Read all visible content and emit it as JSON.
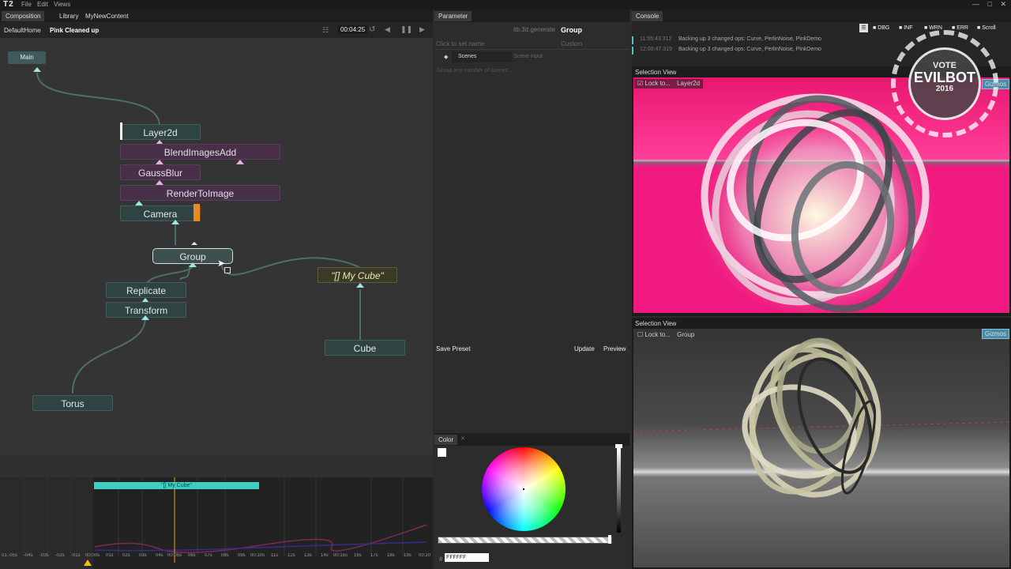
{
  "app": {
    "logo": "T2",
    "menu": [
      "File",
      "Edit",
      "Views"
    ]
  },
  "composition": {
    "tabs": [
      "Composition",
      "Library",
      "MyNewContent"
    ],
    "breadcrumb": [
      "DefaultHome",
      "Pink Cleaned up"
    ],
    "time": "00:04:25",
    "main_label": "Main",
    "nodes": {
      "layer2d": "Layer2d",
      "blend": "BlendImagesAdd",
      "gauss": "GaussBlur",
      "render": "RenderToImage",
      "camera": "Camera",
      "group": "Group",
      "mycube": "\"[] My Cube\"",
      "replicate": "Replicate",
      "transform": "Transform",
      "cube": "Cube",
      "torus": "Torus"
    }
  },
  "timeline": {
    "clip_label": "\"[] My Cube\"",
    "ticks": [
      "01:-05s",
      "-04s",
      "-03s",
      "-02s",
      "-01s",
      "00:00s",
      "01s",
      "02s",
      "03s",
      "04s",
      "00:05s",
      "06s",
      "07s",
      "08s",
      "09s",
      "00:10s",
      "11s",
      "12s",
      "13s",
      "14s",
      "00:15s",
      "16s",
      "17s",
      "18s",
      "19s",
      "00:20"
    ]
  },
  "parameter": {
    "tab": "Parameter",
    "namespace": "lib.3d.generate",
    "op_name": "Group",
    "name_placeholder": "Click to set name",
    "custom": "Custom",
    "row_label": "Scenes",
    "row_value": "Scene input",
    "description": "Group any number of scenes .",
    "save_preset": "Save Preset",
    "update": "Update",
    "preview": "Preview"
  },
  "color": {
    "tab": "Color",
    "hex_prefix": "#",
    "hex_value": "FFFFFF"
  },
  "console": {
    "tab": "Console",
    "filters": [
      "DBG",
      "INF",
      "WRN",
      "ERR",
      "Scroll"
    ],
    "lines": [
      {
        "time": "11:55:43.312",
        "text": "Backing up 3 changed ops: Curve, PerlinNoise, PinkDemo"
      },
      {
        "time": "12:00:47.319",
        "text": "Backing up 3 changed ops: Curve, PerlinNoise, PinkDemo"
      }
    ]
  },
  "badge": {
    "line1": "VOTE",
    "line2": "EVILBOT",
    "line3": "2016"
  },
  "view1": {
    "title": "Selection View",
    "lock_label": "Lock to...",
    "target": "Layer2d",
    "gizmo": "Gizmos"
  },
  "view2": {
    "title": "Selection View",
    "lock_label": "Lock to...",
    "target": "Group",
    "gizmo": "Gizmos"
  },
  "colors": {
    "accent_teal": "#3fcfc0",
    "view_pink": "#f0187c"
  }
}
